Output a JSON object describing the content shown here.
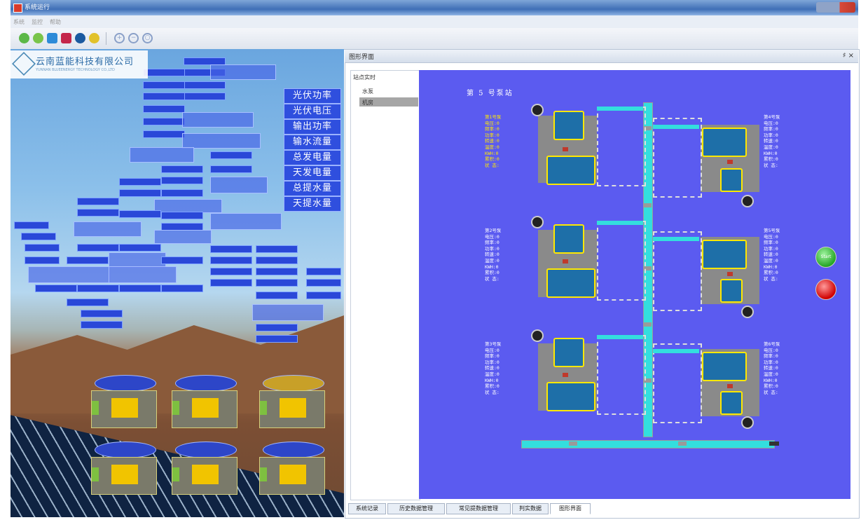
{
  "window": {
    "title": "系统运行"
  },
  "menu": [
    "系统",
    "监控",
    "帮助"
  ],
  "toolbar": {
    "icons": [
      "refresh-icon",
      "connect-icon",
      "edit-icon",
      "database-icon",
      "record-icon",
      "user-icon",
      "zoom-fit-icon",
      "zoom-out-icon",
      "zoom-in-icon"
    ]
  },
  "company": {
    "name": "云南蓝能科技有限公司",
    "subtitle": "YUNNAN BLUEENERGY TECHNOLOGY CO.,LTD"
  },
  "metrics": [
    "光伏功率",
    "光伏电压",
    "输出功率",
    "输水流量",
    "总发电量",
    "天发电量",
    "总提水量",
    "天提水量"
  ],
  "panel": {
    "title": "图形界面",
    "controls": "♯ ×",
    "tree": {
      "header": "站点实时",
      "items": [
        "水泵",
        "机房"
      ],
      "selected": 1
    }
  },
  "station": {
    "title": "第 5 号泵站",
    "pumps": [
      {
        "header": "第1号泵",
        "lines": [
          "电压:0",
          "频率:0",
          "功率:0",
          "转速:0",
          "温度:0",
          "KWH:0",
          "累积:0",
          "状 态:"
        ]
      },
      {
        "header": "第4号泵",
        "lines": [
          "电压:0",
          "频率:0",
          "功率:0",
          "转速:0",
          "温度:0",
          "KWH:0",
          "累积:0",
          "状 态:"
        ]
      },
      {
        "header": "第2号泵",
        "lines": [
          "电压:0",
          "频率:0",
          "功率:0",
          "转速:0",
          "温度:0",
          "KWH:0",
          "累积:0",
          "状 态:"
        ]
      },
      {
        "header": "第5号泵",
        "lines": [
          "电压:0",
          "频率:0",
          "功率:0",
          "转速:0",
          "温度:0",
          "KWH:0",
          "累积:0",
          "状 态:"
        ]
      },
      {
        "header": "第3号泵",
        "lines": [
          "电压:0",
          "频率:0",
          "功率:0",
          "转速:0",
          "温度:0",
          "KWH:0",
          "累积:0",
          "状 态:"
        ]
      },
      {
        "header": "第6号泵",
        "lines": [
          "电压:0",
          "频率:0",
          "功率:0",
          "转速:0",
          "温度:0",
          "KWH:0",
          "累积:0",
          "状 态:"
        ]
      }
    ],
    "start_label": "Start"
  },
  "tabs": [
    "系统记录",
    "历史数据管理",
    "常见提数据管理",
    "判实数据",
    "图形界面"
  ],
  "active_tab": 4,
  "colors": {
    "canvas": "#5b5bf0",
    "pipe": "#33dede",
    "label_yellow": "#ffe800",
    "label_white": "#ffffff",
    "start": "#26a626",
    "stop": "#d00000"
  }
}
